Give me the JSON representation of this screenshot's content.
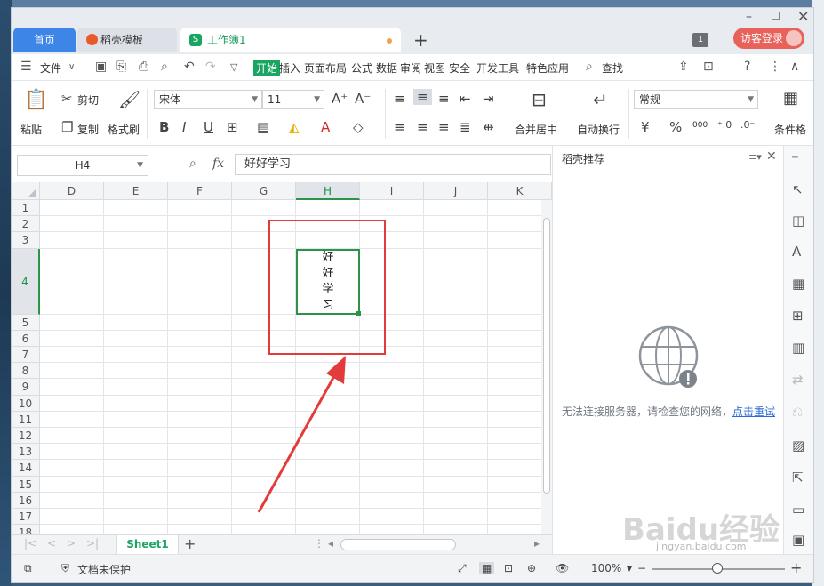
{
  "tabs": {
    "home": "首页",
    "template": "稻壳模板",
    "workbook": "工作簿1",
    "workbook_icon": "S"
  },
  "titlebar": {
    "page_count": "1",
    "login": "访客登录"
  },
  "menu": {
    "file": "文件",
    "items": [
      "开始",
      "插入",
      "页面布局",
      "公式",
      "数据",
      "审阅",
      "视图",
      "安全",
      "开发工具",
      "特色应用"
    ],
    "search": "查找"
  },
  "ribbon": {
    "paste": "粘贴",
    "cut": "剪切",
    "copy": "复制",
    "format_painter": "格式刷",
    "font_name": "宋体",
    "font_size": "11",
    "merge_center": "合并居中",
    "wrap_text": "自动换行",
    "number_format": "常规",
    "percent": "%",
    "thousands": "000",
    "conditional": "条件格"
  },
  "formula_bar": {
    "cell_ref": "H4",
    "fx": "fx",
    "content": "好好学习"
  },
  "grid": {
    "columns": [
      "D",
      "E",
      "F",
      "G",
      "H",
      "I",
      "J",
      "K"
    ],
    "selected_column": "H",
    "rows": [
      "1",
      "2",
      "3",
      "4",
      "5",
      "6",
      "7",
      "8",
      "9",
      "10",
      "11",
      "12",
      "13",
      "14",
      "15",
      "16",
      "17",
      "18"
    ],
    "selected_row": "4",
    "active_cell_text": "好好学习"
  },
  "sheet": {
    "tab": "Sheet1"
  },
  "panel": {
    "title": "稻壳推荐",
    "error": "无法连接服务器，请检查您的网络，",
    "retry": "点击重试"
  },
  "status": {
    "protection": "文档未保护",
    "zoom": "100%"
  },
  "watermark": {
    "text": "Baidu经验",
    "sub": "jingyan.baidu.com"
  },
  "colors": {
    "accent_green": "#1aa562",
    "tab_blue": "#3d86e8",
    "login_red": "#e8615a",
    "annotation_red": "#e23b3b"
  }
}
